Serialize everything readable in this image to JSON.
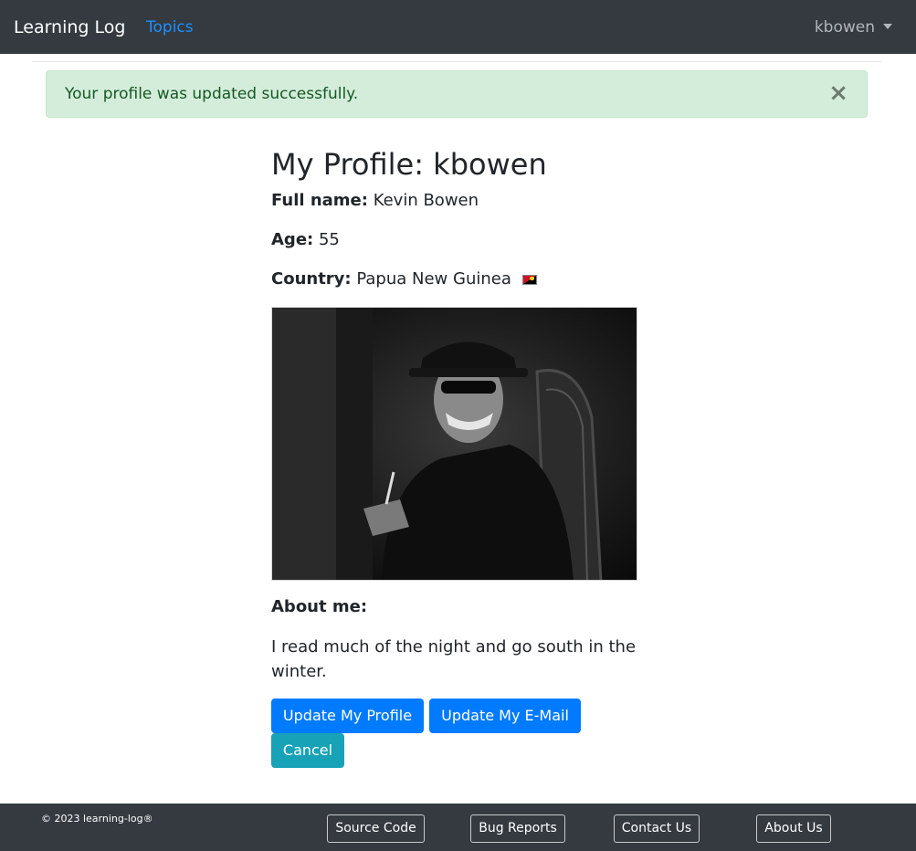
{
  "navbar": {
    "brand": "Learning Log",
    "topics_link": "Topics",
    "user_menu": "kbowen"
  },
  "alert": {
    "message": "Your profile was updated successfully.",
    "close_glyph": "×"
  },
  "profile": {
    "title": "My Profile: kbowen",
    "full_name_label": "Full name:",
    "full_name": "Kevin Bowen",
    "age_label": "Age:",
    "age": "55",
    "country_label": "Country:",
    "country": "Papua New Guinea",
    "country_flag_icon": "papua-new-guinea-flag-icon",
    "photo_icon": "profile-photo",
    "about_label": "About me:",
    "about_text": "I read much of the night and go south in the winter."
  },
  "actions": {
    "update_profile": "Update My Profile",
    "update_email": "Update My E-Mail",
    "cancel": "Cancel"
  },
  "footer": {
    "copyright": "© 2023 learning-log®",
    "source_code": "Source Code",
    "bug_reports": "Bug Reports",
    "contact_us": "Contact Us",
    "about_us": "About Us"
  },
  "colors": {
    "navbar_bg": "#343a40",
    "link": "#1e90ff",
    "primary": "#007bff",
    "info": "#17a2b8",
    "alert_bg": "#d4edda",
    "alert_text": "#155724"
  }
}
